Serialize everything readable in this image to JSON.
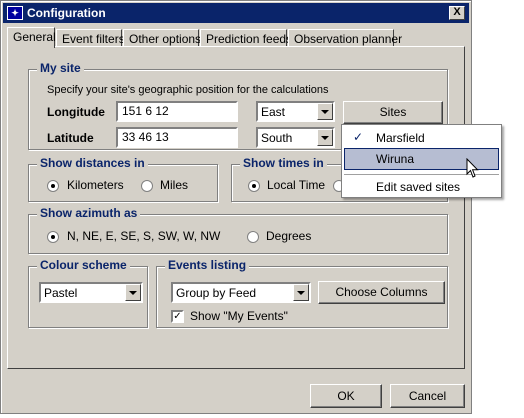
{
  "window": {
    "title": "Configuration",
    "close_glyph": "X",
    "app_icon": "starfield-icon"
  },
  "tabs": [
    {
      "label": "General",
      "active": true
    },
    {
      "label": "Event filters",
      "active": false
    },
    {
      "label": "Other options",
      "active": false
    },
    {
      "label": "Prediction feeds",
      "active": false
    },
    {
      "label": "Observation planner",
      "active": false
    }
  ],
  "my_site": {
    "title": "My site",
    "description": "Specify your site's geographic position for the calculations",
    "longitude_label": "Longitude",
    "longitude_value": "151  6 12",
    "longitude_dir": "East",
    "latitude_label": "Latitude",
    "latitude_value": "33 46 13",
    "latitude_dir": "South",
    "sites_button": "Sites"
  },
  "sites_menu": {
    "items": [
      {
        "label": "Marsfield",
        "checked": true,
        "highlighted": false
      },
      {
        "label": "Wiruna",
        "checked": false,
        "highlighted": true
      },
      {
        "label": "Edit saved sites",
        "checked": false,
        "highlighted": false
      }
    ],
    "check_glyph": "✓"
  },
  "distances": {
    "title": "Show distances in",
    "options": [
      "Kilometers",
      "Miles"
    ],
    "selected": "Kilometers"
  },
  "times": {
    "title": "Show times in",
    "options": [
      "Local Time"
    ],
    "selected": "Local Time"
  },
  "azimuth": {
    "title": "Show azimuth as",
    "options": [
      "N, NE, E, SE, S, SW, W, NW",
      "Degrees"
    ],
    "selected": "N, NE, E, SE, S, SW, W, NW"
  },
  "colour_scheme": {
    "title": "Colour scheme",
    "value": "Pastel"
  },
  "events_listing": {
    "title": "Events listing",
    "value": "Group by Feed",
    "choose_columns_button": "Choose Columns",
    "show_my_events_label": "Show \"My Events\"",
    "show_my_events_checked": true,
    "check_glyph": "✓"
  },
  "footer": {
    "ok": "OK",
    "cancel": "Cancel"
  }
}
